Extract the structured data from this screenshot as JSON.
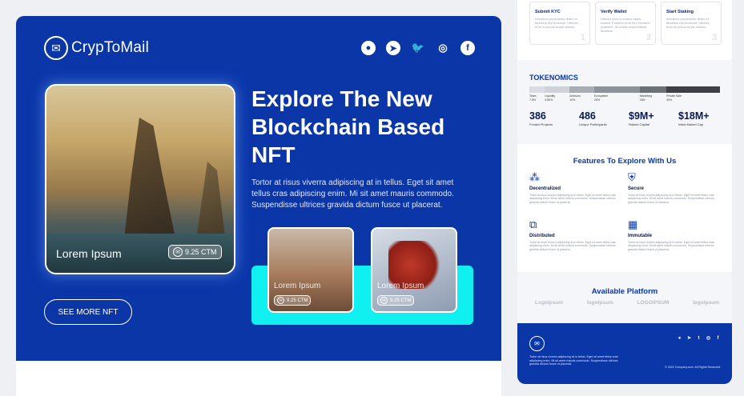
{
  "colors": {
    "hero_bg": "#0a36a8",
    "accent_cyan": "#10f0f0"
  },
  "brand": {
    "name": "CrypToMail"
  },
  "socials": [
    "reddit-icon",
    "telegram-icon",
    "twitter-icon",
    "instagram-icon",
    "facebook-icon"
  ],
  "hero": {
    "title": "Explore The New Blockchain Based NFT",
    "description": "Tortor at risus viverra adipiscing at in tellus. Eget sit amet tellus cras adipiscing enim. Mi sit amet mauris commodo. Suspendisse ultrices gravida dictum fusce ut placerat.",
    "button": "SEE MORE NFT",
    "main_nft": {
      "name": "Lorem Ipsum",
      "price": "9.25 CTM"
    },
    "nfts": [
      {
        "name": "Lorem Ipsum",
        "price": "9.25 CTM"
      },
      {
        "name": "Lorem Ipsum",
        "price": "9.25 CTM"
      }
    ]
  },
  "right": {
    "steps": [
      {
        "title": "Submit KYC",
        "desc": "Interdum consectetur libero id faucibus nisl tincidunt. Ultrices eros in cursus turpis massa.",
        "num": "1"
      },
      {
        "title": "Verify Wallet",
        "desc": "Ultrices eros in cursus turpis massa. Posuere urna nec tincidunt praesent. Id cursus suspendisse faucibus.",
        "num": "2"
      },
      {
        "title": "Start Staking",
        "desc": "Interdum consectetur libero id faucibus nisl tincidunt. Ultrices eros in cursus turpis massa.",
        "num": "3"
      }
    ],
    "tokenomics": {
      "title": "TOKENOMICS",
      "segments": [
        {
          "name": "Team",
          "pct": "7.5%",
          "value": 7.5,
          "color": "#d9dce2"
        },
        {
          "name": "Liquidity",
          "pct": "4.50%",
          "value": 12,
          "color": "#cfd2d8"
        },
        {
          "name": "Advisors",
          "pct": "10%",
          "value": 12,
          "color": "#a9adb4"
        },
        {
          "name": "Ecosystem",
          "pct": "25%",
          "value": 22,
          "color": "#8e9299"
        },
        {
          "name": "Marketing",
          "pct": "18%",
          "value": 13,
          "color": "#6c7077"
        },
        {
          "name": "Private Sale",
          "pct": "30%",
          "value": 26,
          "color": "#3d4046"
        }
      ],
      "stats": [
        {
          "value": "386",
          "label": "Funded Projects"
        },
        {
          "value": "486",
          "label": "Unique Participants"
        },
        {
          "value": "$9M+",
          "label": "Raised Capital"
        },
        {
          "value": "$18M+",
          "label": "Initial Market Cap"
        }
      ]
    },
    "features": {
      "title": "Features To Explore With Us",
      "items": [
        {
          "name": "Decentralized",
          "icon": "network-icon",
          "desc": "Tortor at risus viverra adipiscing at in tellus. Eget sit amet tellus cras adipiscing enim. Mi sit amet mauris commodo. Suspendisse ultrices gravida dictum fusce ut placerat."
        },
        {
          "name": "Secure",
          "icon": "shield-icon",
          "desc": "Tortor at risus viverra adipiscing at in tellus. Eget sit amet tellus cras adipiscing enim. Mi sit amet mauris commodo. Suspendisse ultrices gravida dictum fusce ut placerat."
        },
        {
          "name": "Distributed",
          "icon": "cubes-icon",
          "desc": "Tortor at risus viverra adipiscing at in tellus. Eget sit amet tellus cras adipiscing enim. Mi sit amet mauris commodo. Suspendisse ultrices gravida dictum fusce ut placerat."
        },
        {
          "name": "Immutable",
          "icon": "blocks-icon",
          "desc": "Tortor at risus viverra adipiscing at in tellus. Eget sit amet tellus cras adipiscing enim. Mi sit amet mauris commodo. Suspendisse ultrices gravida dictum fusce ut placerat."
        }
      ]
    },
    "platform": {
      "title": "Available Platform",
      "logos": [
        "Logoipsum",
        "logoipsum",
        "LOGOIPSUM",
        "logoipsum"
      ]
    },
    "footer": {
      "desc": "Tortor at risus viverra adipiscing at in tellus. Eget sit amet tellus cras adipiscing enim. Mi sit amet mauris commodo. Suspendisse ultrices gravida dictum fusce ut placerat.",
      "copyright": "© 2022 Company.com. All Rights Reserved."
    }
  }
}
